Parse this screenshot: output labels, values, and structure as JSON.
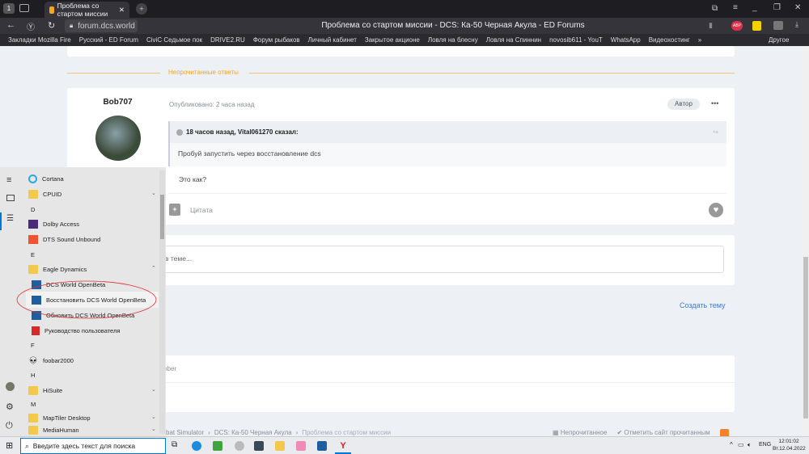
{
  "browser": {
    "tab_count": "1",
    "tab_title": "Проблема со стартом миссии",
    "url": "forum.dcs.world",
    "page_title": "Проблема со стартом миссии - DCS: Ка-50 Черная Акула - ED Forums",
    "abp": "ABP"
  },
  "bookmarks": [
    "Закладки Mozilla Fire",
    "Русский - ED Forum",
    "CiviC Седьмое пок",
    "DRIVE2.RU",
    "Форум рыбаков",
    "Личный кабинет",
    "Закрытое акционе",
    "Ловля на блесну",
    "Ловля на Спиннин",
    "novosib611 - YouT",
    "WhatsApp",
    "Видеохостинг"
  ],
  "bookmarks_more": "»",
  "bookmarks_other": "Другое",
  "forum": {
    "unread_divider": "Непрочитанные ответы",
    "post": {
      "author": "Bob707",
      "published": "Опубликовано: 2 часа назад",
      "badge": "Автор",
      "more": "•••",
      "quote_header": "18 часов назад, Vital061270 сказал:",
      "quote_text": "Пробуй запустить через восстановление dcs",
      "body": "Это как?",
      "quote_button": "Цитата"
    },
    "reply_placeholder": "в теме...",
    "create_topic": "Создать тему",
    "member_text": "mber",
    "breadcrumb": [
      "bat Simulator",
      "DCS: Ка-50 Черная Акула",
      "Проблема со стартом миссии"
    ],
    "footer_unread": "Непрочитанное",
    "footer_mark_read": "Отметить сайт прочитанным"
  },
  "start_menu": {
    "items": [
      {
        "type": "app",
        "label": "Cortana",
        "icon": "cortana-icon"
      },
      {
        "type": "folder",
        "label": "CPUID",
        "expanded": false
      },
      {
        "type": "letter",
        "label": "D"
      },
      {
        "type": "app",
        "label": "Dolby Access",
        "icon": "dolby-icon"
      },
      {
        "type": "app",
        "label": "DTS Sound Unbound",
        "icon": "dts-icon"
      },
      {
        "type": "letter",
        "label": "E"
      },
      {
        "type": "folder",
        "label": "Eagle Dynamics",
        "expanded": true
      },
      {
        "type": "sub",
        "label": "DCS World OpenBeta",
        "icon": "dcs-icon"
      },
      {
        "type": "sub",
        "label": "Восстановить DCS World OpenBeta",
        "icon": "dcs-icon",
        "highlighted": true
      },
      {
        "type": "sub",
        "label": "Обновить DCS World OpenBeta",
        "icon": "dcs-icon"
      },
      {
        "type": "sub",
        "label": "Руководство пользователя",
        "icon": "pdf-icon"
      },
      {
        "type": "letter",
        "label": "F"
      },
      {
        "type": "app",
        "label": "foobar2000",
        "icon": "foobar-icon"
      },
      {
        "type": "letter",
        "label": "H"
      },
      {
        "type": "folder",
        "label": "HiSuite",
        "expanded": false
      },
      {
        "type": "letter",
        "label": "M"
      },
      {
        "type": "folder",
        "label": "MapTiler Desktop",
        "expanded": false
      },
      {
        "type": "folder",
        "label": "MediaHuman",
        "expanded": false
      }
    ]
  },
  "taskbar": {
    "search_placeholder": "Введите здесь текст для поиска",
    "lang": "ENG",
    "time": "12:01:02",
    "date": "Вт.12.04.2022"
  },
  "colors": {
    "accent_orange": "#f5a623",
    "link_blue": "#3a7bd5",
    "annotation_red": "#e03030"
  }
}
